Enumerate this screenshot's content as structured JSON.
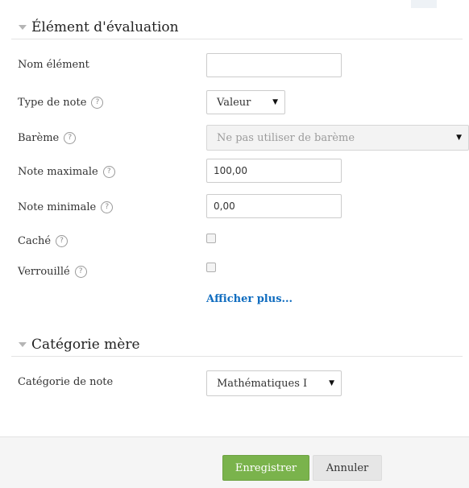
{
  "section_grade_item": {
    "title": "Élément d'évaluation"
  },
  "fields": {
    "item_name": {
      "label": "Nom élément",
      "value": ""
    },
    "grade_type": {
      "label": "Type de note",
      "value": "Valeur"
    },
    "scale": {
      "label": "Barème",
      "value": "Ne pas utiliser de barème"
    },
    "max_grade": {
      "label": "Note maximale",
      "value": "100,00"
    },
    "min_grade": {
      "label": "Note minimale",
      "value": "0,00"
    },
    "hidden": {
      "label": "Caché",
      "checked": false
    },
    "locked": {
      "label": "Verrouillé",
      "checked": false
    }
  },
  "show_more_link": "Afficher plus...",
  "section_parent_category": {
    "title": "Catégorie mère"
  },
  "grade_category": {
    "label": "Catégorie de note",
    "value": "Mathématiques I"
  },
  "buttons": {
    "save": "Enregistrer",
    "cancel": "Annuler"
  },
  "icons": {
    "help": "question-circle-icon",
    "collapse": "caret-down-icon",
    "dropdown": "triangle-down-icon"
  }
}
